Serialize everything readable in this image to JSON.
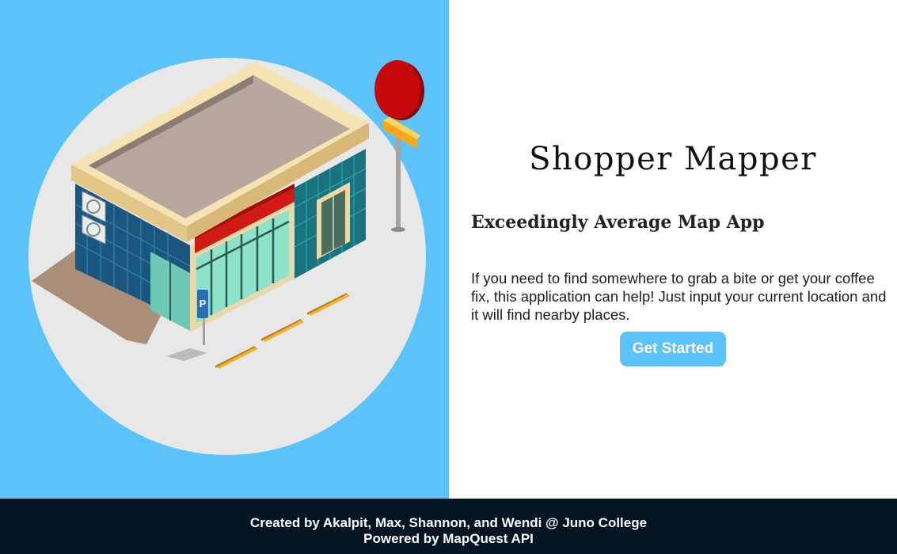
{
  "app": {
    "title": "Shopper Mapper",
    "subtitle": "Exceedingly Average Map App",
    "description": "If you need to find somewhere to grab a bite or get your coffee fix, this application can help! Just input your current location and it will find nearby places.",
    "cta_label": "Get Started"
  },
  "illustration": {
    "subject": "isometric-store-building",
    "sign_letter": "P"
  },
  "footer": {
    "credits": "Created by Akalpit, Max, Shannon, and Wendi @ Juno College",
    "powered_by": "Powered by MapQuest API"
  },
  "colors": {
    "accent": "#5bc2fb",
    "footer_bg": "#031523",
    "circle_bg": "#e8e8e8",
    "sign_red": "#c4080b",
    "awning_red": "#cf1b14",
    "wall_teal": "#19737f"
  }
}
